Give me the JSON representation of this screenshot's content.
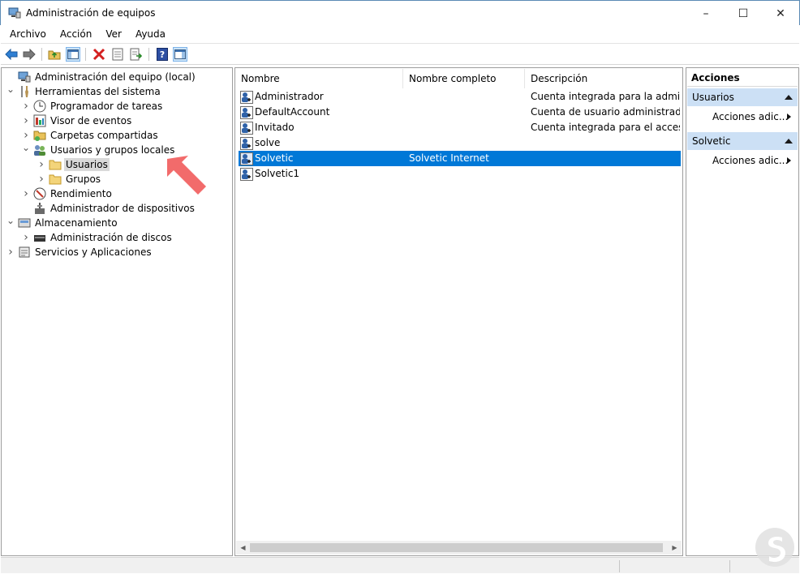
{
  "window": {
    "title": "Administración de equipos",
    "controls": {
      "minimize": "–",
      "maximize": "☐",
      "close": "✕"
    }
  },
  "menu": [
    "Archivo",
    "Acción",
    "Ver",
    "Ayuda"
  ],
  "tree": [
    {
      "label": "Administración del equipo (local)",
      "icon": "computer-management-icon",
      "expander": ""
    },
    {
      "label": "Herramientas del sistema",
      "icon": "tools-icon",
      "expander": "expanded"
    },
    {
      "label": "Programador de tareas",
      "icon": "clock-icon",
      "expander": "collapsed"
    },
    {
      "label": "Visor de eventos",
      "icon": "event-viewer-icon",
      "expander": "collapsed"
    },
    {
      "label": "Carpetas compartidas",
      "icon": "shared-folder-icon",
      "expander": "collapsed"
    },
    {
      "label": "Usuarios y grupos locales",
      "icon": "users-groups-icon",
      "expander": "expanded"
    },
    {
      "label": "Usuarios",
      "icon": "folder-icon",
      "expander": "collapsed",
      "selected": true
    },
    {
      "label": "Grupos",
      "icon": "folder-icon",
      "expander": "collapsed"
    },
    {
      "label": "Rendimiento",
      "icon": "performance-icon",
      "expander": "collapsed"
    },
    {
      "label": "Administrador de dispositivos",
      "icon": "device-manager-icon",
      "expander": ""
    },
    {
      "label": "Almacenamiento",
      "icon": "storage-icon",
      "expander": "expanded"
    },
    {
      "label": "Administración de discos",
      "icon": "disk-icon",
      "expander": "collapsed"
    },
    {
      "label": "Servicios y Aplicaciones",
      "icon": "services-icon",
      "expander": "collapsed"
    }
  ],
  "list": {
    "columns": [
      "Nombre",
      "Nombre completo",
      "Descripción"
    ],
    "rows": [
      {
        "name": "Administrador",
        "fullname": "",
        "description": "Cuenta integrada para la administ..."
      },
      {
        "name": "DefaultAccount",
        "fullname": "",
        "description": "Cuenta de usuario administrada p..."
      },
      {
        "name": "Invitado",
        "fullname": "",
        "description": "Cuenta integrada para el acceso c..."
      },
      {
        "name": "solve",
        "fullname": "",
        "description": ""
      },
      {
        "name": "Solvetic",
        "fullname": "Solvetic Internet",
        "description": "",
        "selected": true
      },
      {
        "name": "Solvetic1",
        "fullname": "",
        "description": ""
      }
    ]
  },
  "actions": {
    "title": "Acciones",
    "sections": [
      {
        "label": "Usuarios",
        "item": "Acciones adic..."
      },
      {
        "label": "Solvetic",
        "item": "Acciones adic..."
      }
    ]
  },
  "colors": {
    "selection": "#0078d7",
    "action_section_bg": "#cce0f5",
    "annotation_arrow": "#f26b6b"
  }
}
